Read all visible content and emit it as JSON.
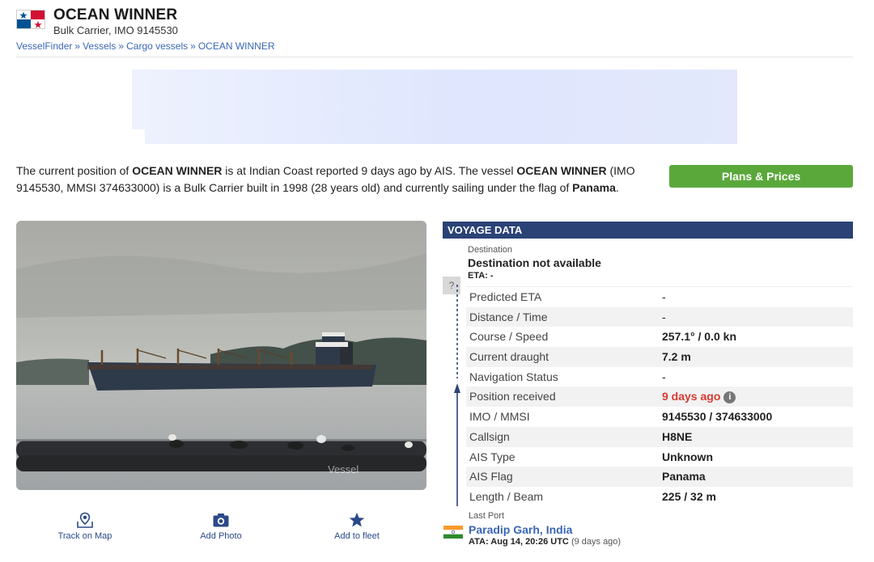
{
  "vessel": {
    "name": "OCEAN WINNER",
    "subtitle": "Bulk Carrier, IMO 9145530"
  },
  "breadcrumb": [
    "VesselFinder",
    "Vessels",
    "Cargo vessels",
    "OCEAN WINNER"
  ],
  "description": {
    "p1": "The current position of ",
    "name1": "OCEAN WINNER",
    "p2": " is at Indian Coast reported 9 days ago by AIS. The vessel ",
    "name2": "OCEAN WINNER",
    "p3": " (IMO 9145530, MMSI 374633000) is a Bulk Carrier built in 1998 (28 years old) and currently sailing under the flag of ",
    "flag": "Panama",
    "p4": "."
  },
  "plans_button": "Plans & Prices",
  "photo": {
    "watermark": "Vessel"
  },
  "actions": {
    "track": "Track on Map",
    "photo": "Add Photo",
    "fleet": "Add to fleet"
  },
  "voyage": {
    "header": "VOYAGE DATA",
    "destination_caption": "Destination",
    "destination_unknown_icon": "?",
    "destination": "Destination not available",
    "eta": "ETA: -",
    "rows": [
      {
        "label": "Predicted ETA",
        "value": "-"
      },
      {
        "label": "Distance / Time",
        "value": "-"
      },
      {
        "label": "Course / Speed",
        "value": "257.1° / 0.0 kn"
      },
      {
        "label": "Current draught",
        "value": "7.2 m"
      },
      {
        "label": "Navigation Status",
        "value": "-"
      },
      {
        "label": "Position received",
        "value": "9 days ago"
      },
      {
        "label": "IMO / MMSI",
        "value": "9145530 / 374633000"
      },
      {
        "label": "Callsign",
        "value": "H8NE"
      },
      {
        "label": "AIS Type",
        "value": "Unknown"
      },
      {
        "label": "AIS Flag",
        "value": "Panama"
      },
      {
        "label": "Length / Beam",
        "value": "225 / 32 m"
      }
    ],
    "info_icon": "i",
    "last_port_caption": "Last Port",
    "last_port": "Paradip Garh, India",
    "ata": "ATA: Aug 14, 20:26 UTC",
    "ata_relative": "(9 days ago)"
  },
  "colors": {
    "header_bar": "#2a4276",
    "button_green": "#5aa83a",
    "link_blue": "#3a66b5",
    "alert_red": "#d93a31"
  },
  "icons": {
    "flag": "panama-flag-icon",
    "track": "map-pin-icon",
    "photo": "camera-icon",
    "fleet": "star-icon",
    "info": "info-icon",
    "last_port_flag": "india-flag-icon"
  }
}
